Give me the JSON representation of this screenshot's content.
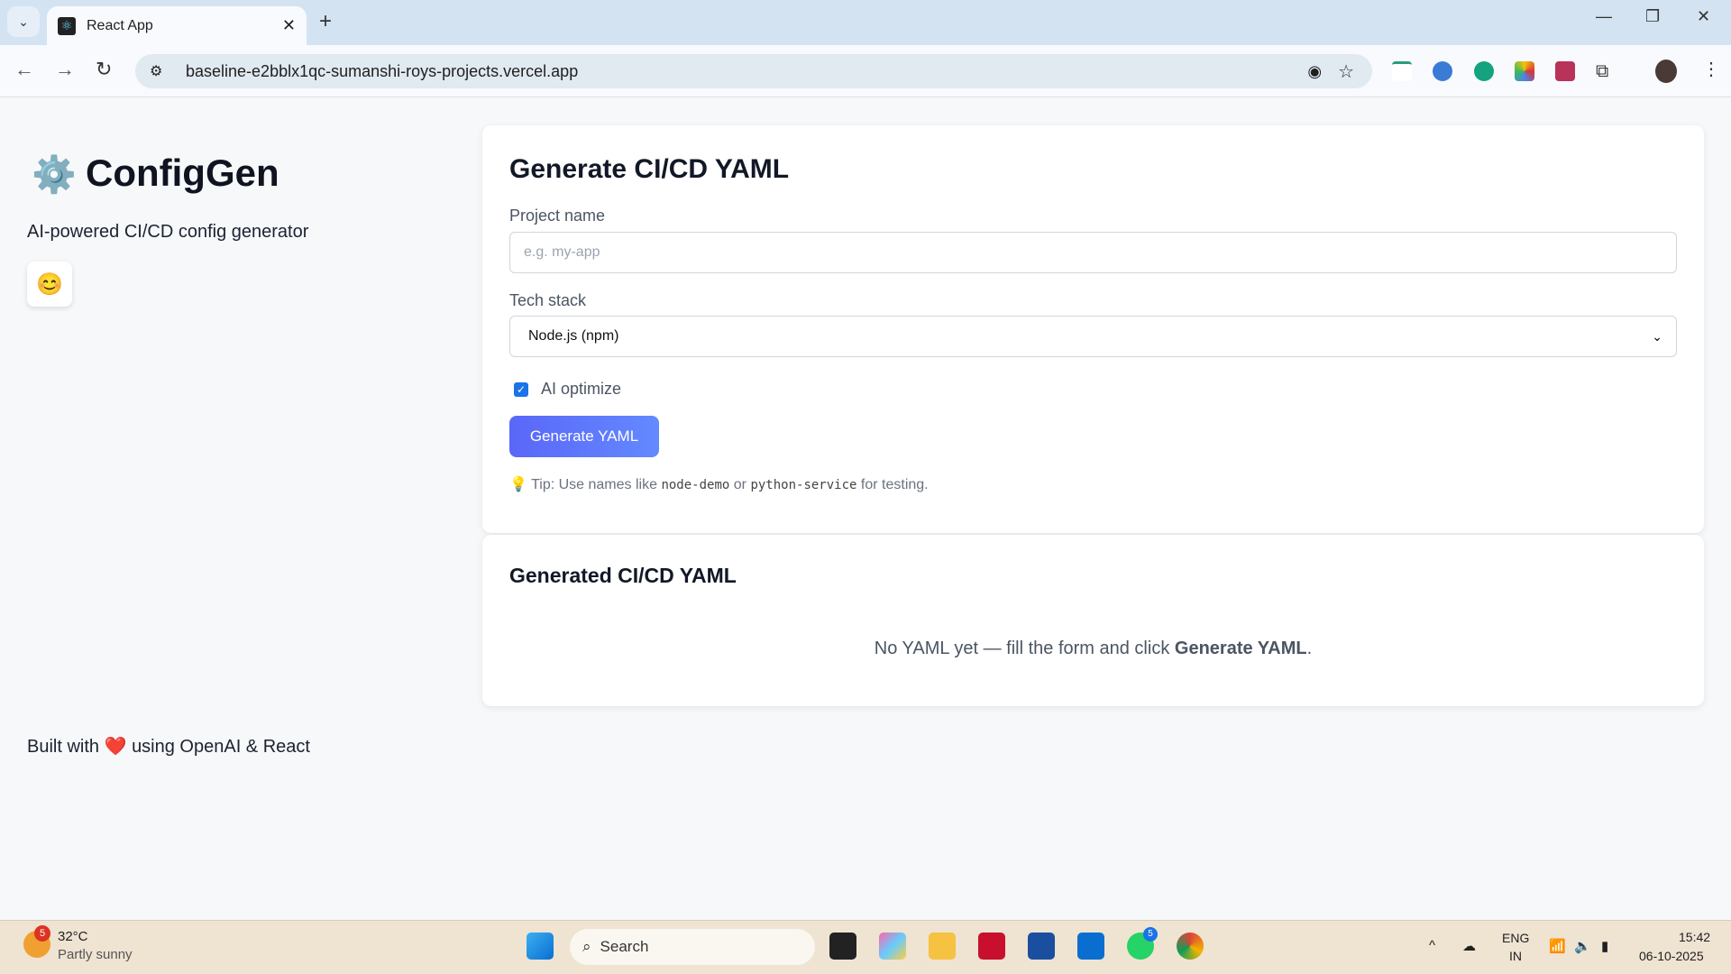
{
  "browser": {
    "tab_title": "React App",
    "url": "baseline-e2bblx1qc-sumanshi-roys-projects.vercel.app"
  },
  "sidebar": {
    "app_name": "ConfigGen",
    "tagline": "AI-powered CI/CD config generator",
    "footer_pre": "Built with",
    "footer_heart": "❤️",
    "footer_post": "using OpenAI & React",
    "theme_emoji": "😊",
    "logo_emoji": "⚙️"
  },
  "form": {
    "title": "Generate CI/CD YAML",
    "project_label": "Project name",
    "project_placeholder": "e.g. my-app",
    "project_value": "",
    "stack_label": "Tech stack",
    "stack_value": "Node.js (npm)",
    "ai_label": "AI optimize",
    "ai_checked": true,
    "button": "Generate YAML",
    "tip_pre": "Tip: Use names like",
    "tip_code1": "node-demo",
    "tip_mid": "or",
    "tip_code2": "python-service",
    "tip_post": "for testing."
  },
  "output": {
    "title": "Generated CI/CD YAML",
    "empty_pre": "No YAML yet — fill the form and click",
    "empty_bold": "Generate YAML",
    "empty_post": "."
  },
  "taskbar": {
    "weather_temp": "32°C",
    "weather_desc": "Partly sunny",
    "weather_badge": "5",
    "search": "Search",
    "whatsapp_badge": "5",
    "lang1": "ENG",
    "lang2": "IN",
    "time": "15:42",
    "date": "06-10-2025"
  },
  "colors": {
    "accent": "#5a67f8",
    "page_bg": "#f7f8fa"
  }
}
